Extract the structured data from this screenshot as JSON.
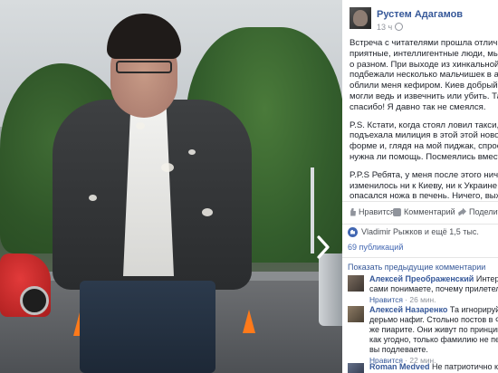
{
  "post": {
    "author": "Рустем Адагамов",
    "time": "13 ч",
    "paragraphs": [
      [
        "Встреча с читателями прошла отлично. Пр",
        "приятные, интеллигентные люди, мы погов",
        "о разном. При выходе из хинкальной сзади",
        "подбежали несколько мальчишек в адидас",
        "облили меня кефиром. Киев добрый город",
        "могли ведь и извечнить или убить. Так что",
        "спасибо! Я давно так не смеялся."
      ],
      [
        "P.S. Кстати, когда стоял ловил такси, тут же",
        "подъехала милиция в этой этой новой чер",
        "форме и, глядя на мой пиджак, спросила н",
        "нужна ли помощь. Посмеялись вместе с н"
      ],
      [
        "P.P.S Ребята, у меня после этого ничего н",
        "изменилось ни к Киеву, ни к Украине. Я пр",
        "опасался ножа в печень. Ничего, выжил."
      ]
    ]
  },
  "actions": {
    "like": "Нравится",
    "comment": "Комментарий",
    "share": "Поделиться"
  },
  "likes_text": "Vladimir Рыжков и ещё 1,5 тыс.",
  "publications_text": "69 публикаций",
  "prev_comments": "Показать предыдущие комментарии",
  "comments": [
    {
      "name": "Алексей Преображенский",
      "lines": [
        "Интересно, вы",
        "сами понимаете, почему прилетел кефир?"
      ],
      "like": "Нравится",
      "time": "26 мин."
    },
    {
      "name": "Алексей Назаренко",
      "lines": [
        "Та игнорируйте вы эт",
        "дерьмо нафиг. Стольно постов в Фейсбуке",
        "же пиарите. Они живут по принципу - назы",
        "как угодно, только фамилию не перепутай",
        "вы подлеваете."
      ],
      "like": "Нравится",
      "time": "22 мин."
    },
    {
      "name": "Roman Medved",
      "lines": [
        "Не патриотично как то, к"
      ],
      "like": "",
      "time": ""
    }
  ],
  "icons": [
    "globe-icon",
    "like-icon",
    "comment-icon",
    "share-icon",
    "thumbs-up-icon",
    "chevron-right-icon"
  ],
  "colors": {
    "link": "#365899",
    "like_badge": "#4267b2",
    "meta": "#90949c"
  }
}
